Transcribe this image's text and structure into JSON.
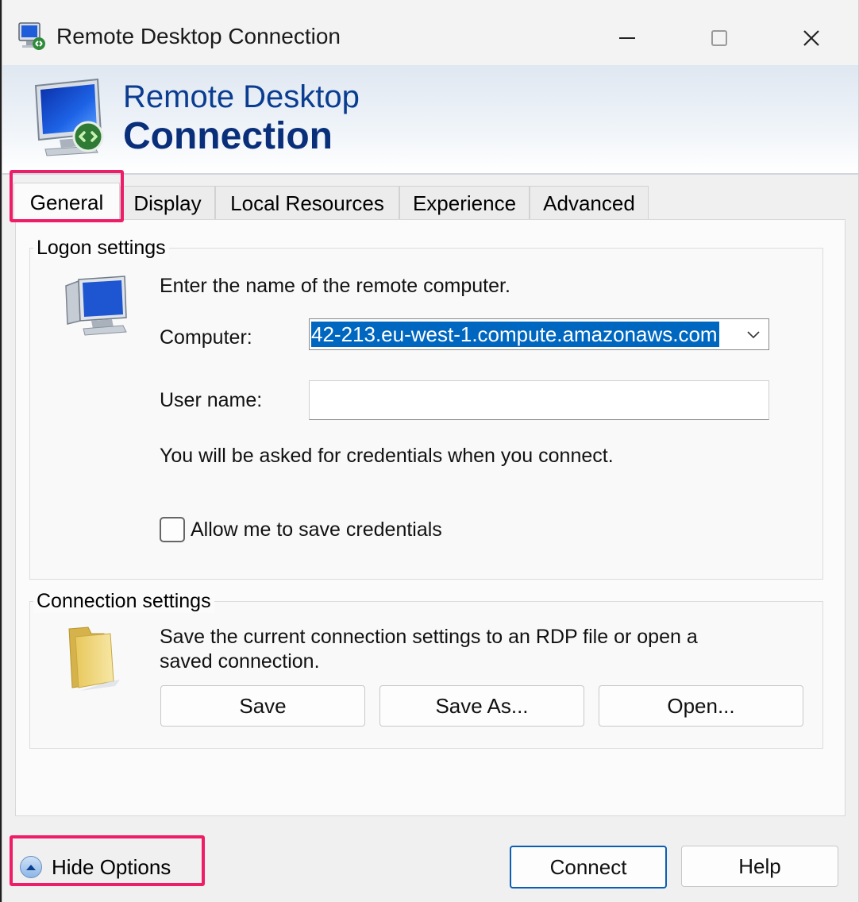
{
  "window": {
    "title": "Remote Desktop Connection",
    "controls": [
      "minimize",
      "maximize",
      "close"
    ]
  },
  "banner": {
    "line1": "Remote Desktop",
    "line2": "Connection"
  },
  "tabs": [
    {
      "label": "General",
      "active": true
    },
    {
      "label": "Display",
      "active": false
    },
    {
      "label": "Local Resources",
      "active": false
    },
    {
      "label": "Experience",
      "active": false
    },
    {
      "label": "Advanced",
      "active": false
    }
  ],
  "logon": {
    "group_title": "Logon settings",
    "instruction": "Enter the name of the remote computer.",
    "computer_label": "Computer:",
    "computer_value": "42-213.eu-west-1.compute.amazonaws.com",
    "username_label": "User name:",
    "username_value": "",
    "credentials_note": "You will be asked for credentials when you connect.",
    "save_credentials_label": "Allow me to save credentials",
    "save_credentials_checked": false
  },
  "connection": {
    "group_title": "Connection settings",
    "description_line1": "Save the current connection settings to an RDP file or open a",
    "description_line2": "saved connection.",
    "save_label": "Save",
    "save_as_label": "Save As...",
    "open_label": "Open..."
  },
  "footer": {
    "hide_options_label": "Hide Options",
    "connect_label": "Connect",
    "help_label": "Help"
  },
  "colors": {
    "highlight": "#ef1c67",
    "selection": "#0067c0",
    "banner_text": "#0a3d91"
  }
}
